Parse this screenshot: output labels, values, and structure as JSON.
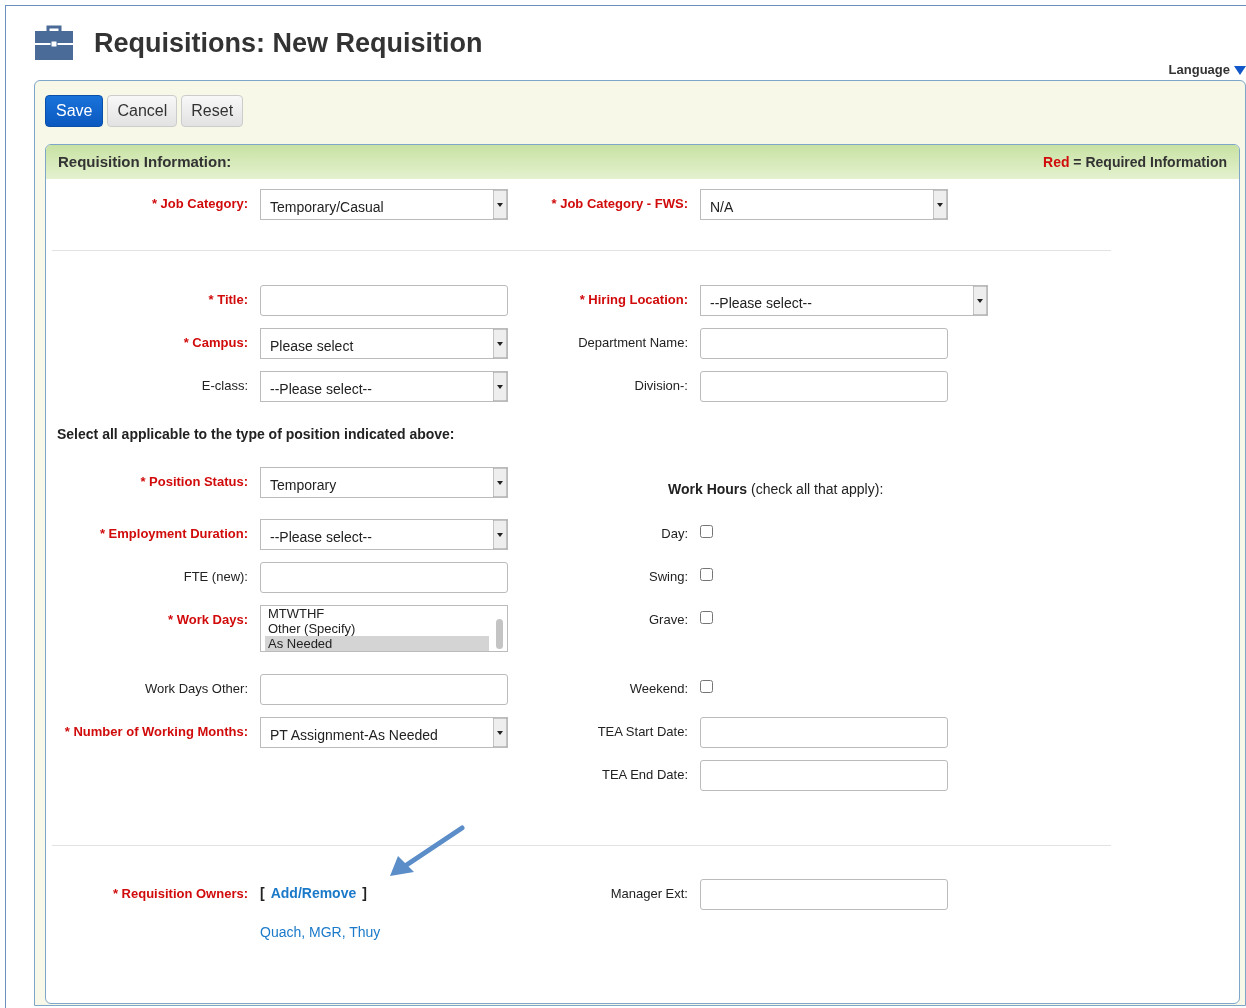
{
  "page": {
    "title": "Requisitions: New Requisition",
    "language": "Language"
  },
  "toolbar": {
    "buttons": [
      {
        "label": "Save",
        "primary": true
      },
      {
        "label": "Cancel",
        "primary": false
      },
      {
        "label": "Reset",
        "primary": false
      }
    ]
  },
  "panel": {
    "title": "Requisition Information:",
    "legend": "**Red** = Required Information"
  },
  "sections": [
    {
      "rows": [
        {
          "left": {
            "kind": "select",
            "label": "* Job Category:",
            "required": true,
            "value": "Temporary/Casual"
          },
          "right": {
            "kind": "select",
            "label": "* Job Category - FWS:",
            "required": true,
            "value": "N/A"
          }
        }
      ]
    },
    {
      "rows": [
        {
          "left": {
            "kind": "text",
            "label": "* Title:",
            "required": true
          },
          "right": {
            "kind": "select",
            "label": "* Hiring Location:",
            "required": true,
            "value": "--Please select--",
            "wide": true
          }
        },
        {
          "left": {
            "kind": "select",
            "label": "* Campus:",
            "required": true,
            "value": "Please select"
          },
          "right": {
            "kind": "text",
            "label": "Department Name:",
            "required": false
          }
        },
        {
          "left": {
            "kind": "select",
            "label": "E-class:",
            "required": false,
            "value": "--Please select--"
          },
          "right": {
            "kind": "text",
            "label": "Division-:",
            "required": false
          }
        },
        {
          "note": "Select all applicable to the type of position indicated above:"
        },
        {
          "left": {
            "kind": "select",
            "label": "* Position Status:",
            "required": true,
            "value": "Temporary"
          },
          "right": {
            "kind": "heading",
            "text": "**Work Hours** (check all that apply):"
          }
        },
        {
          "left": {
            "kind": "select",
            "label": "* Employment Duration:",
            "required": true,
            "value": "--Please select--"
          },
          "right": {
            "kind": "checkbox",
            "label": "Day:",
            "required": false,
            "checked": false
          }
        },
        {
          "left": {
            "kind": "text",
            "label": "FTE (new):",
            "required": false
          },
          "right": {
            "kind": "checkbox",
            "label": "Swing:",
            "required": false,
            "checked": false
          }
        },
        {
          "left": {
            "kind": "listbox",
            "label": "* Work Days:",
            "required": true,
            "options": [
              {
                "label": "MTWTHF",
                "selected": false
              },
              {
                "label": "Other (Specify)",
                "selected": false
              },
              {
                "label": "As Needed",
                "selected": true
              }
            ]
          },
          "right": {
            "kind": "checkbox",
            "label": "Grave:",
            "required": false,
            "checked": false
          }
        },
        {
          "left": {
            "kind": "text",
            "label": "Work Days Other:",
            "required": false
          },
          "right": {
            "kind": "checkbox",
            "label": "Weekend:",
            "required": false,
            "checked": false
          }
        },
        {
          "left": {
            "kind": "select",
            "label": "* Number of Working Months:",
            "required": true,
            "value": "PT Assignment-As Needed"
          },
          "right": {
            "kind": "text",
            "label": "TEA Start Date:",
            "required": false
          }
        },
        {
          "right": {
            "kind": "text",
            "label": "TEA End Date:",
            "required": false
          }
        }
      ]
    },
    {
      "rows": [
        {
          "left": {
            "kind": "owners",
            "label": "* Requisition Owners:",
            "required": true,
            "open": "[",
            "link": "Add/Remove",
            "close": "]",
            "names": "Quach, MGR, Thuy"
          },
          "right": {
            "kind": "text",
            "label": "Manager Ext:",
            "required": false
          }
        }
      ]
    }
  ]
}
